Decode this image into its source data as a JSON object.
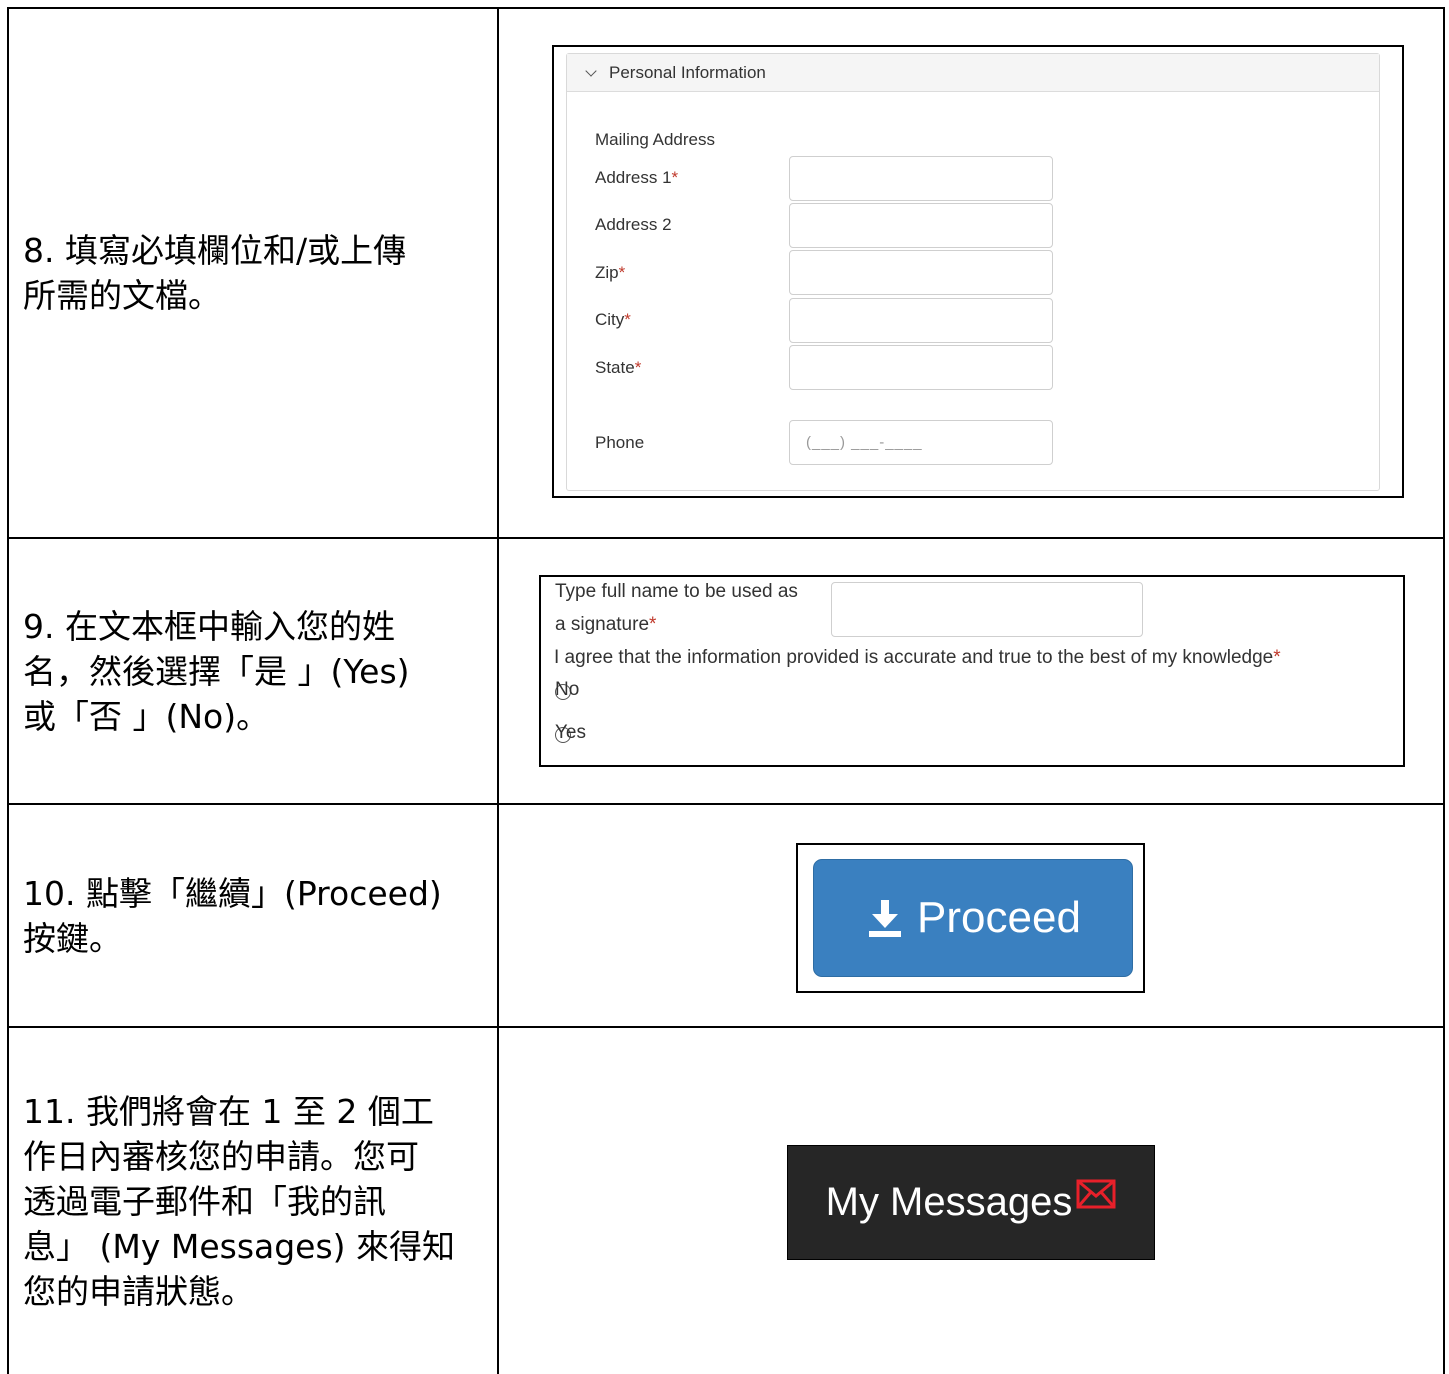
{
  "steps": [
    {
      "text": "8.  填寫必填欄位和/或上傳\n所需的文檔。"
    },
    {
      "text": "9.  在文本框中輸入您的姓\n名，然後選擇「是 」(Yes)\n或「否 」(No)。"
    },
    {
      "text": "10. 點擊「繼續」(Proceed)\n按鍵。"
    },
    {
      "text": "11. 我們將會在 1 至 2 個工\n作日內審核您的申請。您可\n透過電子郵件和「我的訊\n息」 (My Messages) 來得知\n您的申請狀態。"
    }
  ],
  "personal_info": {
    "panel_title": "Personal Information",
    "mailing_address_label": "Mailing Address",
    "address1_label": "Address 1",
    "address2_label": "Address 2",
    "zip_label": "Zip",
    "city_label": "City",
    "state_label": "State",
    "phone_label": "Phone",
    "phone_placeholder": "(___) ___-____",
    "required_mark": "*"
  },
  "signature": {
    "label_line1": "Type full name to be used as",
    "label_line2": "a signature",
    "agree_text": "I agree that the information provided is accurate and true to the best of my knowledge",
    "options": [
      "No",
      "Yes"
    ],
    "required_mark": "*"
  },
  "proceed": {
    "label": "Proceed",
    "icon": "download-icon"
  },
  "messages": {
    "label": "My Messages",
    "icon": "envelope-icon",
    "icon_color": "#e8202a"
  },
  "colors": {
    "button_blue": "#3a80c0",
    "messages_bg": "#262626",
    "required_red": "#c0392b"
  }
}
